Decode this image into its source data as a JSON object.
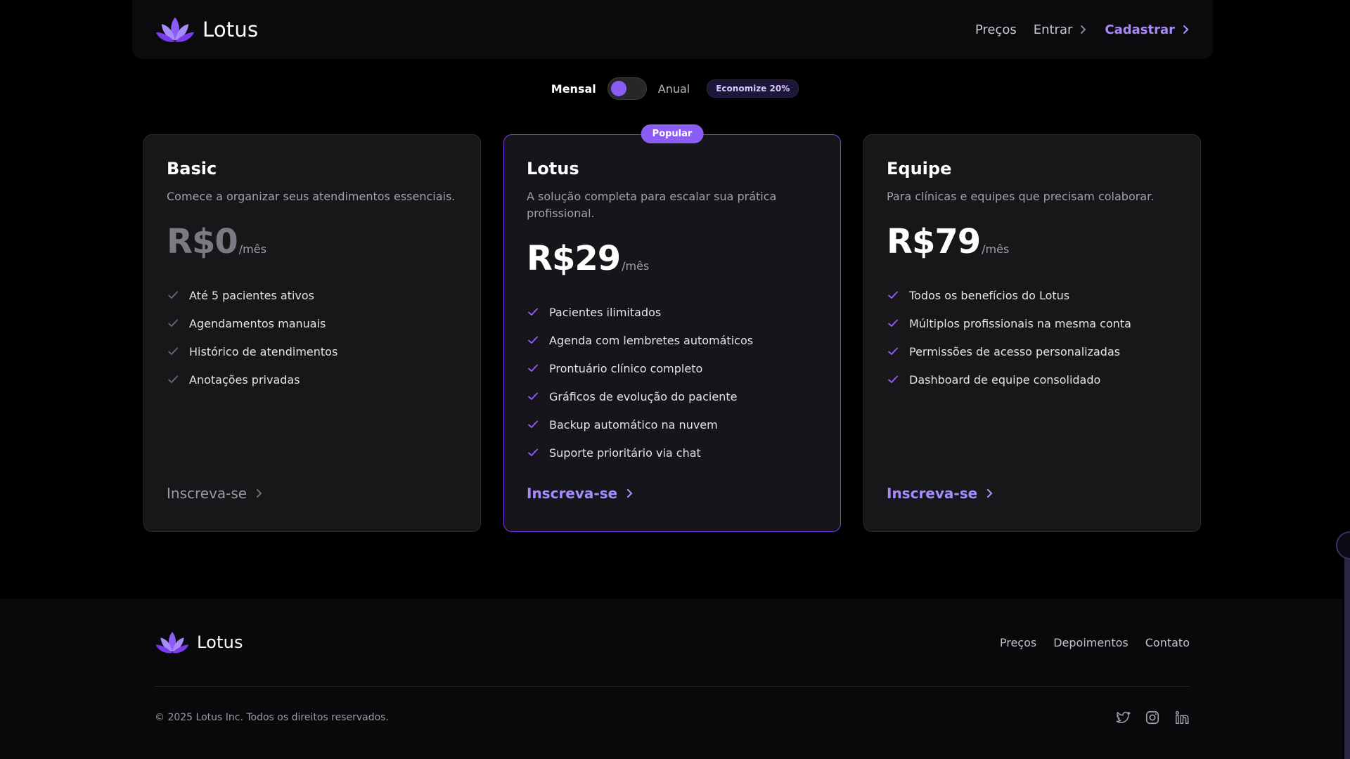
{
  "header": {
    "brand": "Lotus",
    "nav": {
      "pricing": "Preços",
      "login": "Entrar",
      "signup": "Cadastrar"
    }
  },
  "billing": {
    "monthly": "Mensal",
    "annual": "Anual",
    "selected": "Mensal",
    "savings_badge": "Economize 20%"
  },
  "plans": [
    {
      "name": "Basic",
      "description": "Comece a organizar seus atendimentos essenciais.",
      "price": "R$0",
      "period": "/mês",
      "features": [
        "Até 5 pacientes ativos",
        "Agendamentos manuais",
        "Histórico de atendimentos",
        "Anotações privadas"
      ],
      "cta": "Inscreva-se"
    },
    {
      "name": "Lotus",
      "badge": "Popular",
      "description": "A solução completa para escalar sua prática profissional.",
      "price": "R$29",
      "period": "/mês",
      "features": [
        "Pacientes ilimitados",
        "Agenda com lembretes automáticos",
        "Prontuário clínico completo",
        "Gráficos de evolução do paciente",
        "Backup automático na nuvem",
        "Suporte prioritário via chat"
      ],
      "cta": "Inscreva-se"
    },
    {
      "name": "Equipe",
      "description": "Para clínicas e equipes que precisam colaborar.",
      "price": "R$79",
      "period": "/mês",
      "features": [
        "Todos os benefícios do Lotus",
        "Múltiplos profissionais na mesma conta",
        "Permissões de acesso personalizadas",
        "Dashboard de equipe consolidado"
      ],
      "cta": "Inscreva-se"
    }
  ],
  "footer": {
    "brand": "Lotus",
    "links": {
      "pricing": "Preços",
      "testimonials": "Depoimentos",
      "contact": "Contato"
    },
    "copyright": "© 2025 Lotus Inc. Todos os direitos reservados.",
    "socials": [
      "twitter-icon",
      "instagram-icon",
      "linkedin-icon"
    ]
  },
  "colors": {
    "accent": "#8b5cf6",
    "accent_text": "#a78bfa",
    "background": "#000000",
    "card": "#17171a"
  }
}
